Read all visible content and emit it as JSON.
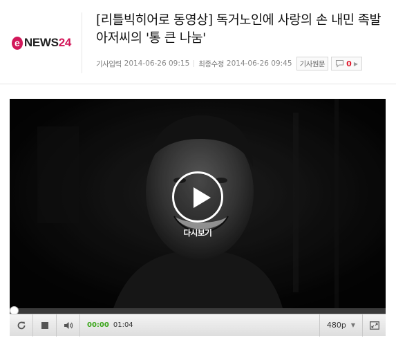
{
  "site": {
    "logo_mark": "e",
    "logo_word": "NEWS",
    "logo_num": "24",
    "brand_color": "#d2185a"
  },
  "article": {
    "title": "[리틀빅히어로 동영상] 독거노인에 사랑의 손 내민 족발아저씨의 '통 큰 나눔'",
    "published_label": "기사입력",
    "published_value": "2014-06-26 09:15",
    "modified_label": "최종수정",
    "modified_value": "2014-06-26 09:45",
    "original_button": "기사원문",
    "comment_count": "0",
    "comment_icon": "speech-bubble-icon"
  },
  "player": {
    "replay_label": "다시보기",
    "current_time": "00:00",
    "duration": "01:04",
    "progress": 0,
    "quality": "480p",
    "icons": {
      "play": "play-icon",
      "refresh": "refresh-icon",
      "stop": "stop-icon",
      "volume": "volume-icon",
      "fullscreen": "fullscreen-icon"
    },
    "accent_time_color": "#3aa61a"
  }
}
